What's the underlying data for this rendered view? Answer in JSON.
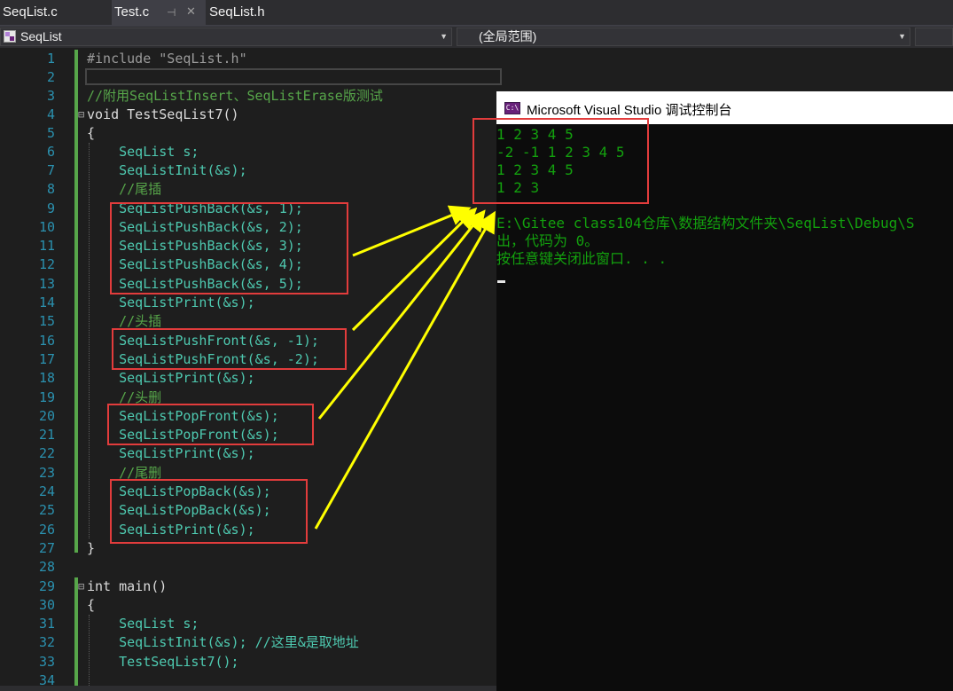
{
  "tabs": [
    {
      "label": "SeqList.c",
      "active": false
    },
    {
      "label": "Test.c",
      "active": true
    },
    {
      "label": "SeqList.h",
      "active": false
    }
  ],
  "tab_pin_icon": "pin-icon",
  "tab_close_icon": "close-icon",
  "navbar": {
    "scope_combo": "SeqList",
    "member_combo": "(全局范围)"
  },
  "editor": {
    "line_numbers": [
      "1",
      "2",
      "3",
      "4",
      "5",
      "6",
      "7",
      "8",
      "9",
      "10",
      "11",
      "12",
      "13",
      "14",
      "15",
      "16",
      "17",
      "18",
      "19",
      "20",
      "21",
      "22",
      "23",
      "24",
      "25",
      "26",
      "27",
      "28",
      "29",
      "30",
      "31",
      "32",
      "33",
      "34"
    ],
    "lines": [
      "#include \"SeqList.h\"",
      "",
      "//附用SeqListInsert、SeqListErase版测试",
      "void TestSeqList7()",
      "{",
      "    SeqList s;",
      "    SeqListInit(&s);",
      "    //尾插",
      "    SeqListPushBack(&s, 1);",
      "    SeqListPushBack(&s, 2);",
      "    SeqListPushBack(&s, 3);",
      "    SeqListPushBack(&s, 4);",
      "    SeqListPushBack(&s, 5);",
      "    SeqListPrint(&s);",
      "    //头插",
      "    SeqListPushFront(&s, -1);",
      "    SeqListPushFront(&s, -2);",
      "    SeqListPrint(&s);",
      "    //头删",
      "    SeqListPopFront(&s);",
      "    SeqListPopFront(&s);",
      "    SeqListPrint(&s);",
      "    //尾删",
      "    SeqListPopBack(&s);",
      "    SeqListPopBack(&s);",
      "    SeqListPrint(&s);",
      "}",
      "",
      "int main()",
      "{",
      "    SeqList s;",
      "    SeqListInit(&s); //这里&是取地址",
      "    TestSeqList7();",
      ""
    ]
  },
  "console": {
    "title": "Microsoft Visual Studio 调试控制台",
    "icon": "visual-studio-console-icon",
    "output": [
      "1 2 3 4 5",
      "-2 -1 1 2 3 4 5",
      "1 2 3 4 5",
      "1 2 3"
    ],
    "messages": [
      "E:\\Gitee class104仓库\\数据结构文件夹\\SeqList\\Debug\\S",
      "出，代码为 0。",
      "按任意键关闭此窗口. . ."
    ]
  },
  "colors": {
    "annotation_box": "#e23c3c",
    "annotation_arrow": "#ffff00",
    "console_text": "#13a10e"
  }
}
